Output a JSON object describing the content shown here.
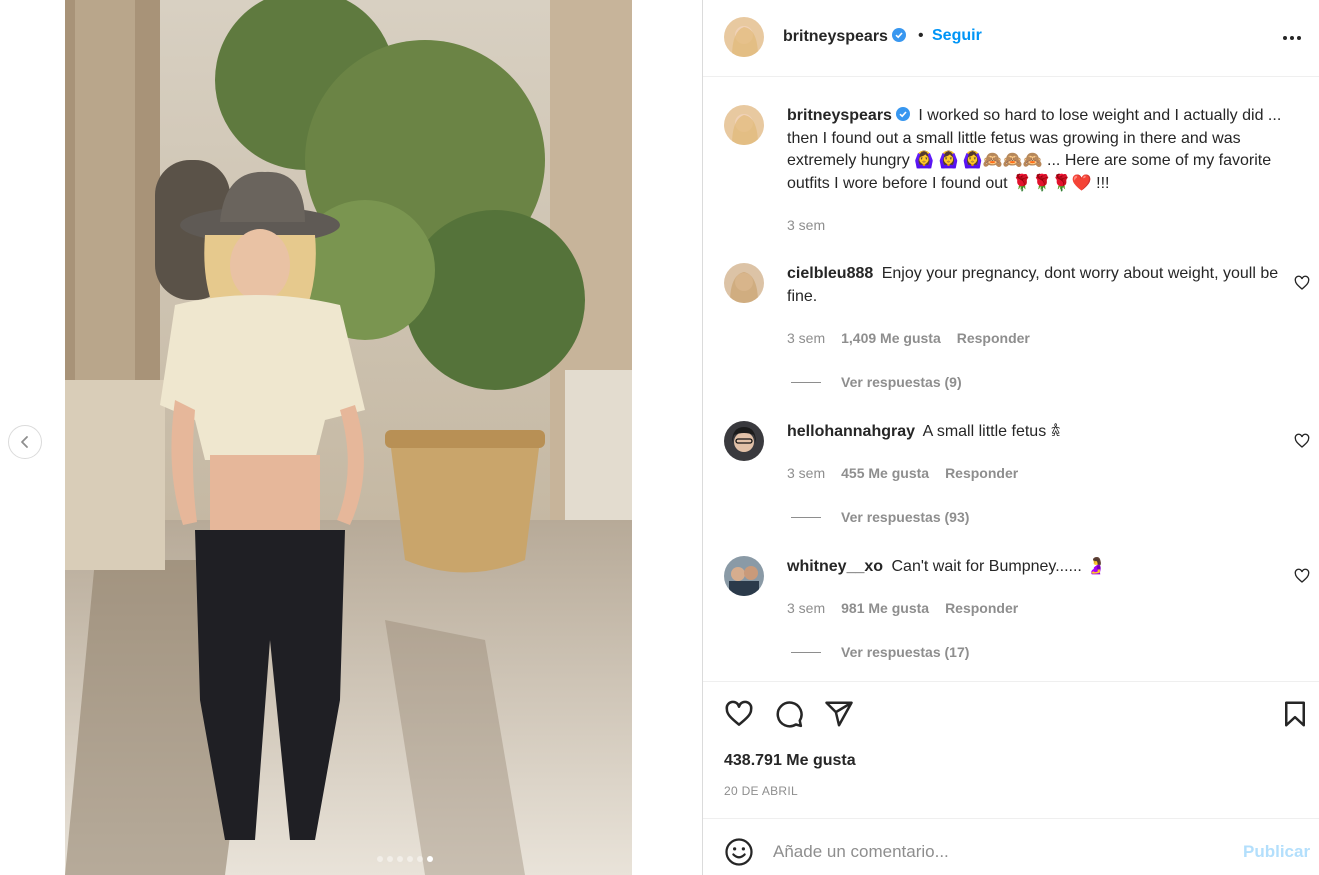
{
  "post": {
    "author": "britneyspears",
    "follow_label": "Seguir",
    "separator": "•",
    "caption_text": "I worked so hard to lose weight and I actually did ... then I found out a small little fetus was growing in there and was extremely hungry 🙆‍♀️ 🙆‍♀️ 🙆‍♀️🙈🙈🙈 ... Here are some of my favorite outfits I wore before I found out 🌹🌹🌹❤️ !!!",
    "caption_time": "3 sem",
    "likes": "438.791 Me gusta",
    "date": "20 DE ABRIL",
    "carousel": {
      "slides": 6,
      "active_index": 5
    }
  },
  "comments": [
    {
      "user": "cielbleu888",
      "text": "Enjoy your pregnancy, dont worry about weight, youll be fine.",
      "time": "3 sem",
      "likes": "1,409 Me gusta",
      "reply_label": "Responder",
      "replies_label": "Ver respuestas (9)"
    },
    {
      "user": "hellohannahgray",
      "text": "A small little fetus 𖠋",
      "time": "3 sem",
      "likes": "455 Me gusta",
      "reply_label": "Responder",
      "replies_label": "Ver respuestas (93)"
    },
    {
      "user": "whitney__xo",
      "text": "Can't wait for Bumpney...... 🤰",
      "time": "3 sem",
      "likes": "981 Me gusta",
      "reply_label": "Responder",
      "replies_label": "Ver respuestas (17)"
    }
  ],
  "composer": {
    "placeholder": "Añade un comentario...",
    "publish_label": "Publicar"
  },
  "icons": {
    "verified": "verified-badge-icon",
    "more": "more-options-icon",
    "like": "heart-icon",
    "comment": "comment-icon",
    "share": "paper-plane-icon",
    "save": "bookmark-icon",
    "emoji": "emoji-icon",
    "prev": "chevron-left-icon"
  },
  "colors": {
    "accent": "#0095f6",
    "publish_disabled": "#b3dffc",
    "text": "#262626",
    "muted": "#8e8e8e"
  }
}
